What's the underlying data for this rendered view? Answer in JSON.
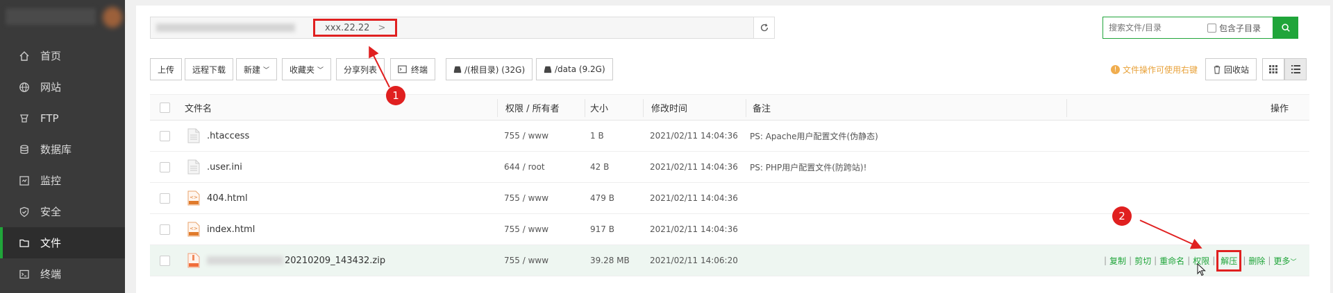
{
  "sidebar": {
    "items": [
      {
        "label": "首页",
        "icon": "home-icon"
      },
      {
        "label": "网站",
        "icon": "globe-icon"
      },
      {
        "label": "FTP",
        "icon": "ftp-icon"
      },
      {
        "label": "数据库",
        "icon": "database-icon"
      },
      {
        "label": "监控",
        "icon": "monitor-icon"
      },
      {
        "label": "安全",
        "icon": "shield-icon"
      },
      {
        "label": "文件",
        "icon": "folder-icon",
        "active": true
      },
      {
        "label": "终端",
        "icon": "terminal-icon"
      }
    ]
  },
  "pathbar": {
    "crumb": "xxx.22.22",
    "crumb_chevron": ">"
  },
  "search": {
    "placeholder": "搜索文件/目录",
    "subdir_label": "包含子目录"
  },
  "toolbar": {
    "upload": "上传",
    "remote_download": "远程下载",
    "new": "新建",
    "favorites": "收藏夹",
    "share_list": "分享列表",
    "terminal": "终端",
    "disk_root": "/(根目录) (32G)",
    "disk_data": "/data (9.2G)",
    "tip": "文件操作可使用右键",
    "recycle": "回收站"
  },
  "table": {
    "headers": {
      "name": "文件名",
      "perm": "权限 / 所有者",
      "size": "大小",
      "mtime": "修改时间",
      "note": "备注",
      "ops": "操作"
    },
    "rows": [
      {
        "name": ".htaccess",
        "perm": "755 / www",
        "size": "1 B",
        "mtime": "2021/02/11 14:04:36",
        "note": "PS: Apache用户配置文件(伪静态)",
        "type": "file"
      },
      {
        "name": ".user.ini",
        "perm": "644 / root",
        "size": "42 B",
        "mtime": "2021/02/11 14:04:36",
        "note": "PS: PHP用户配置文件(防跨站)!",
        "type": "file"
      },
      {
        "name": "404.html",
        "perm": "755 / www",
        "size": "479 B",
        "mtime": "2021/02/11 14:04:36",
        "note": "",
        "type": "html"
      },
      {
        "name": "index.html",
        "perm": "755 / www",
        "size": "917 B",
        "mtime": "2021/02/11 14:04:36",
        "note": "",
        "type": "html"
      },
      {
        "name": "20210209_143432.zip",
        "perm": "755 / www",
        "size": "39.28 MB",
        "mtime": "2021/02/11 14:06:20",
        "note": "",
        "type": "zip"
      }
    ],
    "ops": {
      "copy": "复制",
      "cut": "剪切",
      "rename": "重命名",
      "perm": "权限",
      "unzip": "解压",
      "delete": "删除",
      "more": "更多"
    }
  },
  "annotations": {
    "badge1": "1",
    "badge2": "2"
  },
  "colors": {
    "accent": "#20a53a",
    "annotation": "#e02020",
    "tip": "#e8a23a",
    "sidebar_bg": "#3a3a3a"
  }
}
